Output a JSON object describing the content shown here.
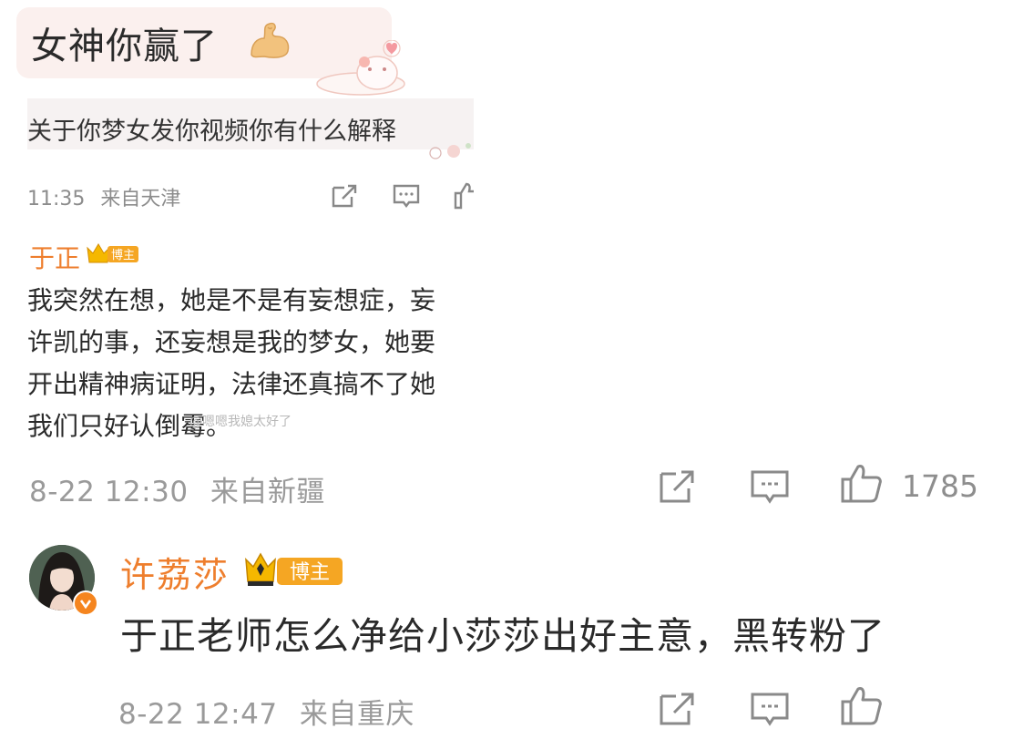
{
  "screenshot": {
    "bubble_text": "女神你赢了",
    "quote_text": "关于你梦女发你视频你有什么解释",
    "meta": {
      "time": "11:35",
      "location": "来自天津"
    },
    "author": {
      "name": "于正",
      "badge": "博主"
    },
    "comment_lines": [
      "我突然在想，她是不是有妄想症，妄",
      "许凯的事，还妄想是我的梦女，她要",
      "开出精神病证明，法律还真搞不了她",
      "我们只好认倒霉。"
    ],
    "watermark": "@嗯嗯我媳太好了"
  },
  "comment": {
    "date": "8-22 12:30",
    "location": "来自新疆",
    "likes": "1785"
  },
  "reply": {
    "author": "许荔莎",
    "badge": "博主",
    "text": "于正老师怎么净给小莎莎出好主意，黑转粉了",
    "date": "8-22 12:47",
    "location": "来自重庆"
  },
  "colors": {
    "author_orange": "#ee7e2d",
    "meta_gray": "#9a9a9a",
    "badge_gold": "#f5b800"
  },
  "icons": [
    "flexed-biceps-icon",
    "share-icon",
    "comment-icon",
    "like-icon",
    "crown-icon",
    "verified-icon"
  ]
}
